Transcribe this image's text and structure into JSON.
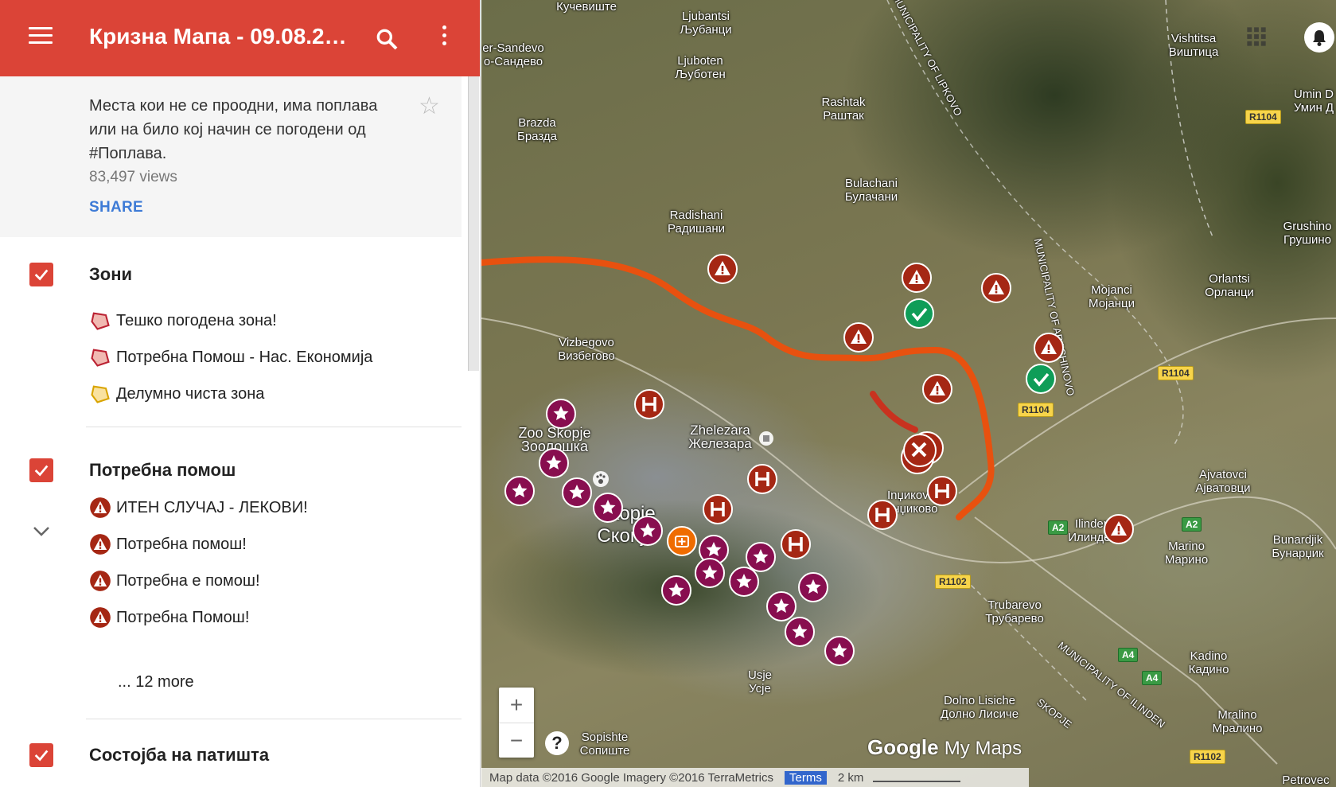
{
  "app": {
    "title": "Кризна Мапа - 09.08.2…",
    "description": "Места кои не се проодни, има поплава или на било кој начин се погодени од #Поплава.",
    "views": "83,497 views",
    "share_label": "SHARE"
  },
  "layers": [
    {
      "title": "Зони",
      "items": [
        {
          "label": "Тешко погодена зона!",
          "icon": "polygon-red-icon",
          "color": "#e06455"
        },
        {
          "label": "Потребна Помош - Нас. Економија",
          "icon": "polygon-red-icon",
          "color": "#e06455"
        },
        {
          "label": "Делумно чиста зона",
          "icon": "polygon-yellow-icon",
          "color": "#f4c542"
        }
      ]
    },
    {
      "title": "Потребна помош",
      "items": [
        {
          "label": "ИТЕН СЛУЧАЈ - ЛЕКОВИ!",
          "icon": "warning-marker-icon",
          "color": "#a52714"
        },
        {
          "label": "Потребна помош!",
          "icon": "warning-marker-icon",
          "color": "#a52714"
        },
        {
          "label": "Потребна е помош!",
          "icon": "warning-marker-icon",
          "color": "#a52714"
        },
        {
          "label": "Потребна Помош!",
          "icon": "warning-marker-icon",
          "color": "#a52714"
        }
      ],
      "more": "... 12 more"
    },
    {
      "title": "Состојба на патишта",
      "items": []
    }
  ],
  "map": {
    "labels": [
      {
        "t1": "Кучевиште",
        "t2": ""
      },
      {
        "t1": "Ljubantsi",
        "t2": "Љубанци"
      },
      {
        "t1": "Ljuboten",
        "t2": "Љуботен"
      },
      {
        "t1": "Rashtak",
        "t2": "Раштак"
      },
      {
        "t1": "Brazda",
        "t2": "Бразда"
      },
      {
        "t1": "er-Sandevo",
        "t2": "о-Сандево"
      },
      {
        "t1": "Bulachani",
        "t2": "Булачани"
      },
      {
        "t1": "Radishani",
        "t2": "Радишани"
      },
      {
        "t1": "Vishtitsa",
        "t2": "Виштица"
      },
      {
        "t1": "Grushino",
        "t2": "Грушино"
      },
      {
        "t1": "Mojanci",
        "t2": "Мојанци"
      },
      {
        "t1": "Orlantsi",
        "t2": "Орланци"
      },
      {
        "t1": "Vizbegovo",
        "t2": "Визбегово"
      },
      {
        "t1": "Zoo Skopje",
        "t2": "Зоолошка"
      },
      {
        "t1": "Zhelezara",
        "t2": "Железара"
      },
      {
        "t1": "Ajvatovci",
        "t2": "Ајватовци"
      },
      {
        "t1": "Bunardjik",
        "t2": "Бунарџик"
      },
      {
        "t1": "Marino",
        "t2": "Марино"
      },
      {
        "t1": "Trubarevo",
        "t2": "Трубарево"
      },
      {
        "t1": "Kadino",
        "t2": "Кадино"
      },
      {
        "t1": "Usje",
        "t2": "Усје"
      },
      {
        "t1": "Dolno Lisiche",
        "t2": "Долно Лисиче"
      },
      {
        "t1": "Mralino",
        "t2": "Мралино"
      },
      {
        "t1": "Sopishte",
        "t2": "Сопиште"
      },
      {
        "t1": "Inџикоvo",
        "t2": "Инџиково"
      },
      {
        "t1": "Ilinden",
        "t2": "Илинден"
      },
      {
        "t1": "Umin D",
        "t2": "Умин Д"
      },
      {
        "t1": "Skopje",
        "t2": "Скопје"
      },
      {
        "t1": "Petrovec",
        "t2": ""
      }
    ],
    "roads": [
      "R1104",
      "R1104",
      "R1104",
      "A2",
      "A2",
      "R1102",
      "A4",
      "A4",
      "R1102"
    ],
    "municipality_labels": [
      "MUNICIPALITY OF LIPKOVO",
      "MUNICIPALITY OF ARACHINOVO",
      "MUNICIPALITY OF ILINDEN",
      "SKOPJE"
    ],
    "attribution": "Map data ©2016 Google Imagery ©2016 TerraMetrics",
    "terms": "Terms",
    "scale": "2 km",
    "logo": "Google",
    "logo_suffix": "My Maps",
    "zoom_in": "+",
    "zoom_out": "−",
    "help": "?"
  },
  "colors": {
    "appbar": "#db4437",
    "route": "#e8510f",
    "warning_marker": "#a52714",
    "star_marker": "#880e4f",
    "check_marker": "#0f9d58"
  }
}
